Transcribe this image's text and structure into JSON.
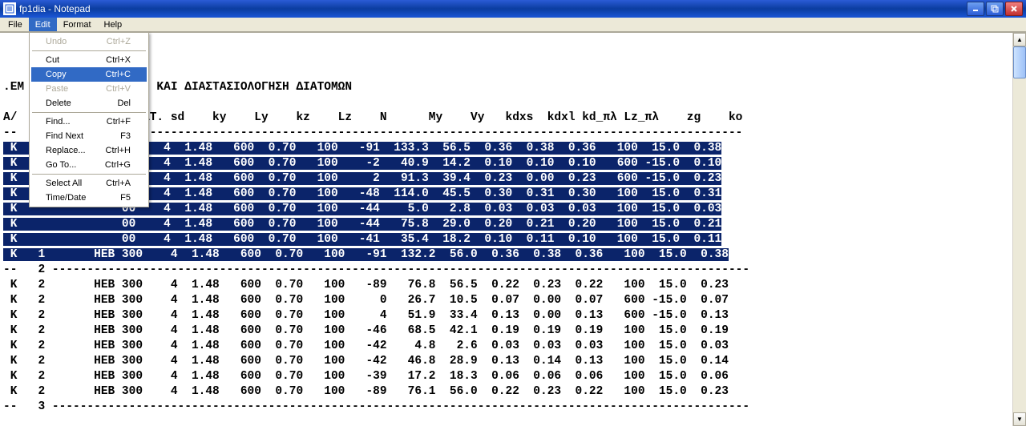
{
  "window": {
    "title": "fp1dia - Notepad"
  },
  "menubar": [
    "File",
    "Edit",
    "Format",
    "Help"
  ],
  "menu_open_index": 1,
  "edit_menu": [
    {
      "label": "Undo",
      "short": "Ctrl+Z",
      "disabled": true
    },
    {
      "sep": true
    },
    {
      "label": "Cut",
      "short": "Ctrl+X"
    },
    {
      "label": "Copy",
      "short": "Ctrl+C",
      "hl": true
    },
    {
      "label": "Paste",
      "short": "Ctrl+V",
      "disabled": true
    },
    {
      "label": "Delete",
      "short": "Del"
    },
    {
      "sep": true
    },
    {
      "label": "Find...",
      "short": "Ctrl+F"
    },
    {
      "label": "Find Next",
      "short": "F3"
    },
    {
      "label": "Replace...",
      "short": "Ctrl+H"
    },
    {
      "label": "Go To...",
      "short": "Ctrl+G"
    },
    {
      "sep": true
    },
    {
      "label": "Select All",
      "short": "Ctrl+A"
    },
    {
      "label": "Time/Date",
      "short": "F5"
    }
  ],
  "text": {
    "blank_lines": 3,
    "heading": ".ΕΜ                   ΚΑΙ ΔΙΑΣΤΑΣΙΟΛΟΓΗΣΗ ΔΙΑΤΟΜΩΝ",
    "cols_line1": "A/                 ΙΑΤ. sd    ky    Ly    kz    Lz    N      My    Vy   kdxs  kdxl kd_πλ Lz_πλ    zg    ko",
    "cols_line2": "--               -----------------------------------------------------------------------------------------",
    "selected_rows": [
      " K               00    4  1.48   600  0.70   100   -91  133.3  56.5  0.36  0.38  0.36   100  15.0  0.38",
      " K               00    4  1.48   600  0.70   100    -2   40.9  14.2  0.10  0.10  0.10   600 -15.0  0.10",
      " K               00    4  1.48   600  0.70   100     2   91.3  39.4  0.23  0.00  0.23   600 -15.0  0.23",
      " K               00    4  1.48   600  0.70   100   -48  114.0  45.5  0.30  0.31  0.30   100  15.0  0.31",
      " K               00    4  1.48   600  0.70   100   -44    5.0   2.8  0.03  0.03  0.03   100  15.0  0.03",
      " K               00    4  1.48   600  0.70   100   -44   75.8  29.0  0.20  0.21  0.20   100  15.0  0.21",
      " K               00    4  1.48   600  0.70   100   -41   35.4  18.2  0.10  0.11  0.10   100  15.0  0.11",
      " K   1       HEB 300    4  1.48   600  0.70   100   -91  132.2  56.0  0.36  0.38  0.36   100  15.0  0.38"
    ],
    "plain_rows": [
      "--   2 ----------------------------------------------------------------------------------------------------",
      " K   2       HEB 300    4  1.48   600  0.70   100   -89   76.8  56.5  0.22  0.23  0.22   100  15.0  0.23",
      " K   2       HEB 300    4  1.48   600  0.70   100     0   26.7  10.5  0.07  0.00  0.07   600 -15.0  0.07",
      " K   2       HEB 300    4  1.48   600  0.70   100     4   51.9  33.4  0.13  0.00  0.13   600 -15.0  0.13",
      " K   2       HEB 300    4  1.48   600  0.70   100   -46   68.5  42.1  0.19  0.19  0.19   100  15.0  0.19",
      " K   2       HEB 300    4  1.48   600  0.70   100   -42    4.8   2.6  0.03  0.03  0.03   100  15.0  0.03",
      " K   2       HEB 300    4  1.48   600  0.70   100   -42   46.8  28.9  0.13  0.14  0.13   100  15.0  0.14",
      " K   2       HEB 300    4  1.48   600  0.70   100   -39   17.2  18.3  0.06  0.06  0.06   100  15.0  0.06",
      " K   2       HEB 300    4  1.48   600  0.70   100   -89   76.1  56.0  0.22  0.23  0.22   100  15.0  0.23",
      "--   3 ----------------------------------------------------------------------------------------------------"
    ]
  }
}
